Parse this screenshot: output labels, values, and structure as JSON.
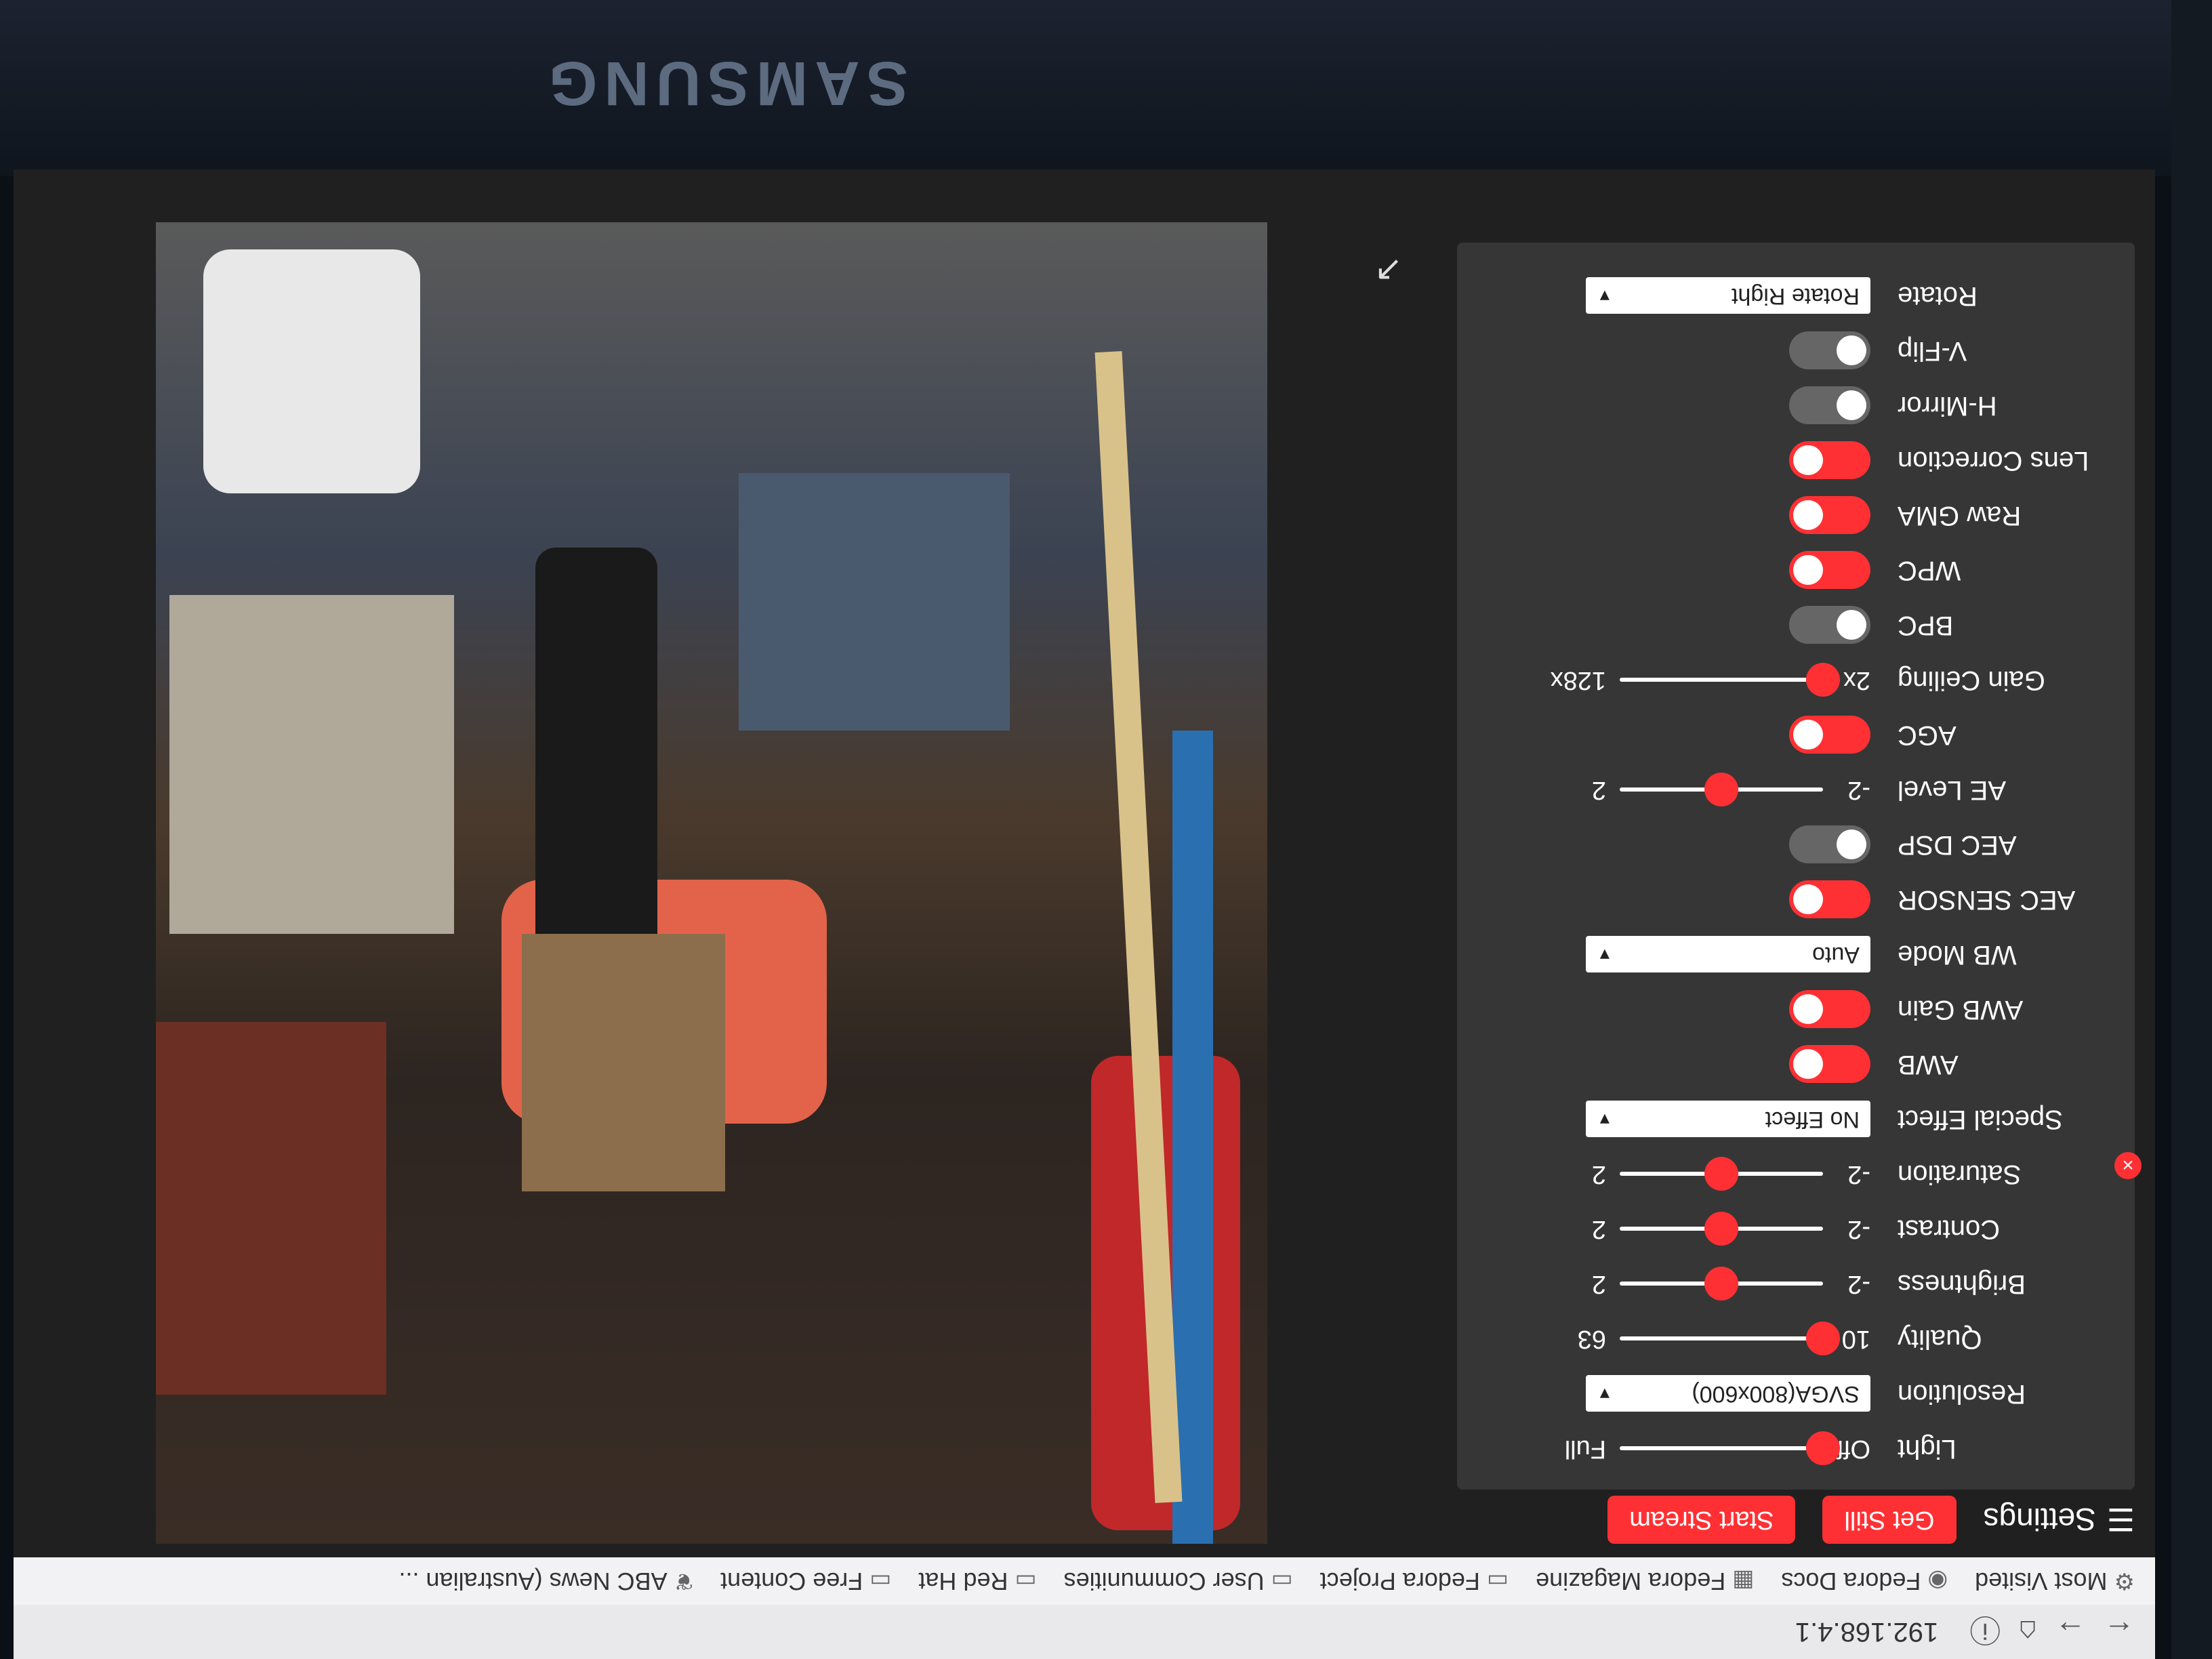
{
  "monitor": {
    "brand": "SAMSUNG"
  },
  "browser": {
    "url": "192.168.4.1",
    "bookmarks": [
      {
        "icon": "gear-icon",
        "label": "Most Visited"
      },
      {
        "icon": "fedora-icon",
        "label": "Fedora Docs"
      },
      {
        "icon": "magazine-icon",
        "label": "Fedora Magazine"
      },
      {
        "icon": "folder-icon",
        "label": "Fedora Project"
      },
      {
        "icon": "folder-icon",
        "label": "User Communities"
      },
      {
        "icon": "folder-icon",
        "label": "Red Hat"
      },
      {
        "icon": "folder-icon",
        "label": "Free Content"
      },
      {
        "icon": "feed-icon",
        "label": "ABC News (Australian ..."
      }
    ]
  },
  "toolbar": {
    "menu_label": "Settings",
    "get_still": "Get Still",
    "start_stream": "Start Stream"
  },
  "settings": {
    "light": {
      "label": "Light",
      "min": "Off",
      "max": "Full",
      "value": 0
    },
    "resolution": {
      "label": "Resolution",
      "value": "SVGA(800x600)"
    },
    "quality": {
      "label": "Quality",
      "min": "10",
      "max": "63",
      "value": 0.0
    },
    "brightness": {
      "label": "Brightness",
      "min": "-2",
      "max": "2",
      "value": 0.5
    },
    "contrast": {
      "label": "Contrast",
      "min": "-2",
      "max": "2",
      "value": 0.5
    },
    "saturation": {
      "label": "Saturation",
      "min": "-2",
      "max": "2",
      "value": 0.5
    },
    "special_effect": {
      "label": "Special Effect",
      "value": "No Effect"
    },
    "awb": {
      "label": "AWB",
      "on": true
    },
    "awb_gain": {
      "label": "AWB Gain",
      "on": true
    },
    "wb_mode": {
      "label": "WB Mode",
      "value": "Auto"
    },
    "aec_sensor": {
      "label": "AEC SENSOR",
      "on": true
    },
    "aec_dsp": {
      "label": "AEC DSP",
      "on": false
    },
    "ae_level": {
      "label": "AE Level",
      "min": "-2",
      "max": "2",
      "value": 0.5
    },
    "agc": {
      "label": "AGC",
      "on": true
    },
    "gain_ceiling": {
      "label": "Gain Ceiling",
      "min": "2x",
      "max": "128x",
      "value": 0.0
    },
    "bpc": {
      "label": "BPC",
      "on": false
    },
    "wpc": {
      "label": "WPC",
      "on": true
    },
    "raw_gma": {
      "label": "Raw GMA",
      "on": true
    },
    "lens_correction": {
      "label": "Lens Correction",
      "on": true
    },
    "h_mirror": {
      "label": "H-Mirror",
      "on": false
    },
    "v_flip": {
      "label": "V-Flip",
      "on": false
    },
    "rotate": {
      "label": "Rotate",
      "value": "Rotate Right"
    }
  },
  "colors": {
    "accent": "#ff3034",
    "panel": "#363636",
    "background": "#202020"
  }
}
